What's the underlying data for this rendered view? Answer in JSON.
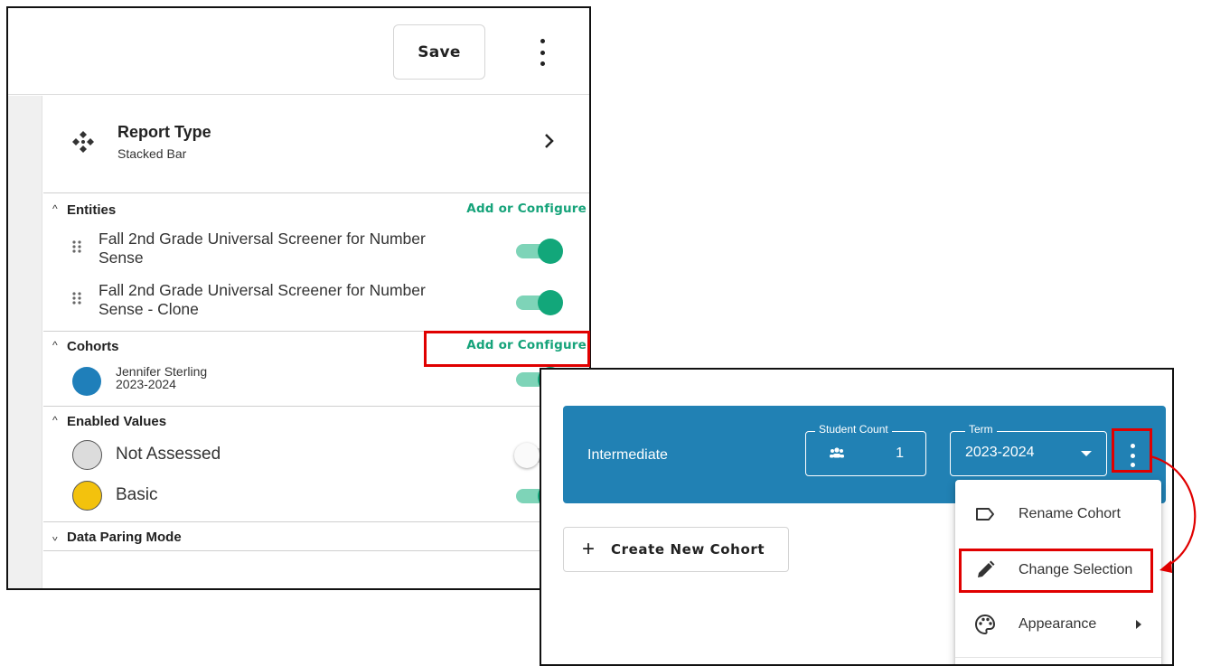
{
  "header": {
    "save_label": "Save",
    "menu_icon": "more-vert-icon"
  },
  "report_type": {
    "title": "Report Type",
    "subtitle": "Stacked Bar"
  },
  "entities": {
    "title": "Entities",
    "action": "Add or Configure",
    "items": [
      {
        "label": "Fall 2nd Grade Universal Screener for Number Sense",
        "enabled": true
      },
      {
        "label": "Fall 2nd Grade Universal Screener for Number Sense - Clone",
        "enabled": true
      }
    ]
  },
  "cohorts": {
    "title": "Cohorts",
    "action": "Add or Configure",
    "items": [
      {
        "name": "Jennifer Sterling",
        "term": "2023-2024",
        "color": "#1f7fba",
        "enabled": true
      }
    ]
  },
  "enabled_values": {
    "title": "Enabled Values",
    "items": [
      {
        "label": "Not Assessed",
        "color": "#dcdcdc",
        "enabled": false
      },
      {
        "label": "Basic",
        "color": "#f3c20d",
        "enabled": true
      }
    ]
  },
  "data_paring_mode": {
    "title": "Data Paring Mode"
  },
  "cohort_card": {
    "name": "Intermediate",
    "student_count_label": "Student Count",
    "student_count": "1",
    "term_label": "Term",
    "term_value": "2023-2024",
    "color": "#2181b4"
  },
  "create_cohort": {
    "label": "Create New Cohort"
  },
  "cohort_menu": {
    "items": [
      {
        "label": "Rename Cohort",
        "icon": "label-icon"
      },
      {
        "label": "Change Selection",
        "icon": "pencil-icon"
      },
      {
        "label": "Appearance",
        "icon": "palette-icon"
      }
    ]
  },
  "colors": {
    "accent_green": "#16a37a",
    "highlight_red": "#e00000"
  }
}
